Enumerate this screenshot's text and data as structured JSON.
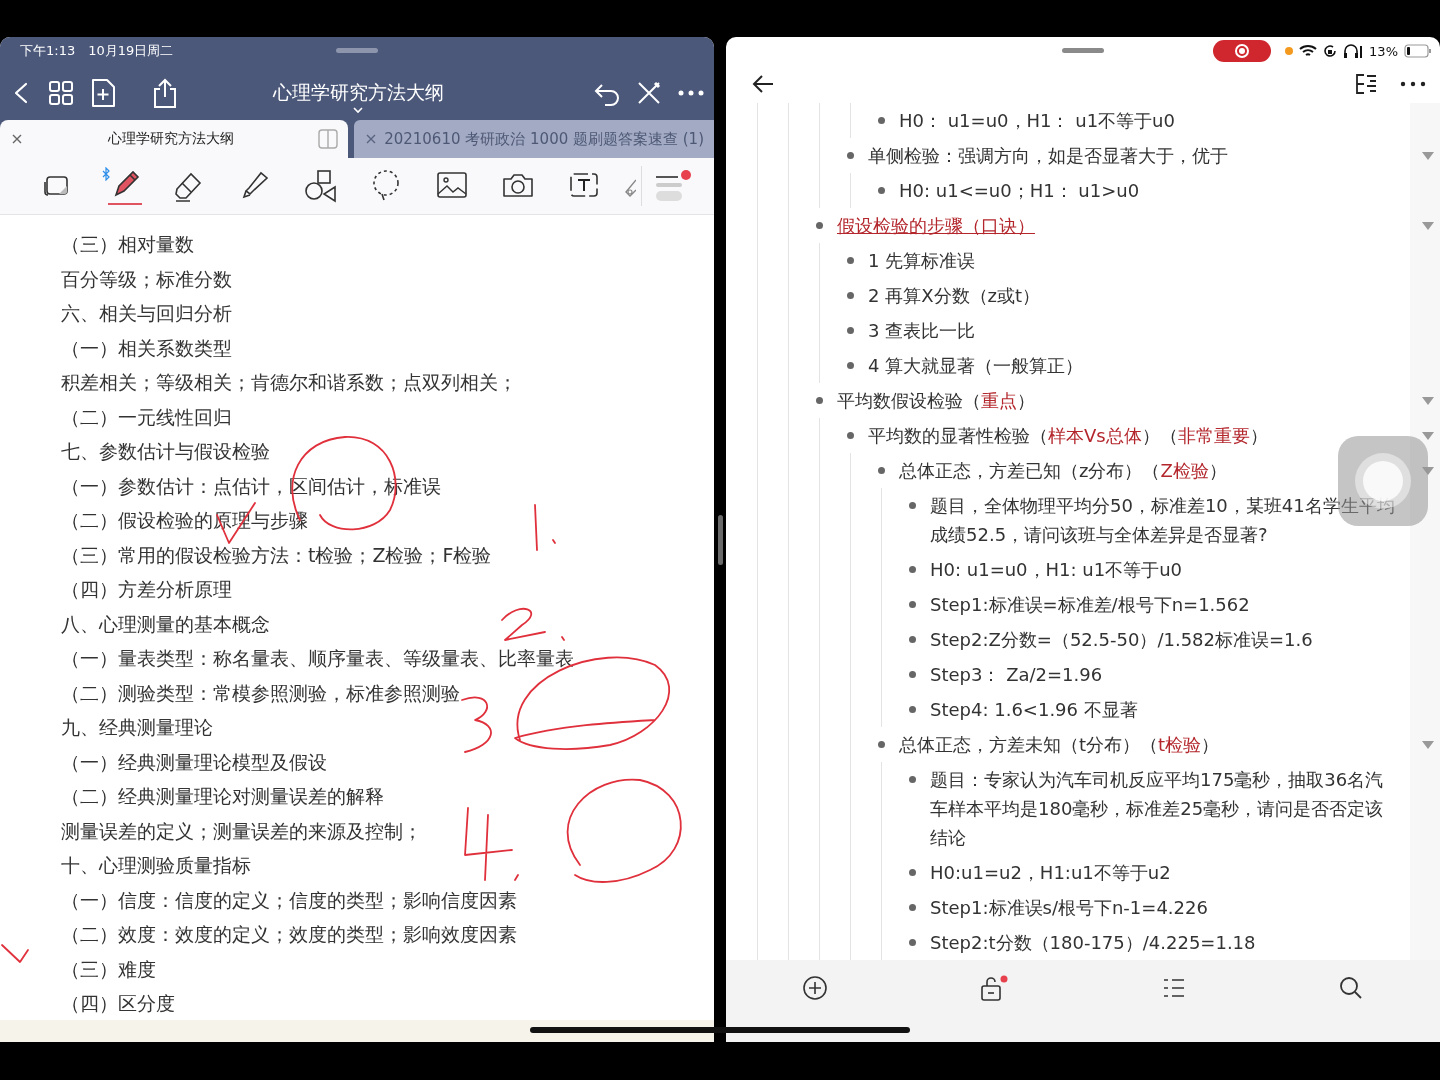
{
  "left_pane": {
    "status_bar": {
      "time": "下午1:13",
      "date": "10月19日周二"
    },
    "title": "心理学研究方法大纲",
    "tabs": [
      {
        "label": "心理学研究方法大纲",
        "selected": true
      },
      {
        "label": "20210610 考研政治 1000 题刷题答案速查 (1)",
        "selected": false
      }
    ],
    "tools": [
      {
        "kind": "page",
        "selected": false
      },
      {
        "kind": "pen",
        "selected": true
      },
      {
        "kind": "eraser",
        "selected": false
      },
      {
        "kind": "highlighter",
        "selected": false
      },
      {
        "kind": "shapes",
        "selected": false
      },
      {
        "kind": "lasso",
        "selected": false
      },
      {
        "kind": "image",
        "selected": false
      },
      {
        "kind": "camera",
        "selected": false
      },
      {
        "kind": "textbox",
        "selected": false
      },
      {
        "kind": "ruler",
        "selected": false
      }
    ],
    "document_lines": [
      "（三）相对量数",
      "百分等级；标准分数",
      "六、相关与回归分析",
      "（一）相关系数类型",
      "积差相关；等级相关；肯德尔和谐系数；点双列相关；",
      "（二）一元线性回归",
      "七、参数估计与假设检验",
      "（一）参数估计：点估计，区间估计，标准误",
      "（二）假设检验的原理与步骤",
      "（三）常用的假设检验方法：t检验；Z检验；F检验",
      "（四）方差分析原理",
      "八、心理测量的基本概念",
      "（一）量表类型：称名量表、顺序量表、等级量表、比率量表",
      "（二）测验类型：常模参照测验，标准参照测验",
      "九、经典测量理论",
      "（一）经典测量理论模型及假设",
      "（二）经典测量理论对测量误差的解释",
      "测量误差的定义；测量误差的来源及控制；",
      "十、心理测验质量指标",
      "（一）信度：信度的定义；信度的类型；影响信度因素",
      "（二）效度：效度的定义；效度的类型；影响效度因素",
      "（三）难度",
      "（四）区分度"
    ]
  },
  "right_pane": {
    "battery": "13%",
    "outline": [
      {
        "children": [
          {
            "children": [
              {
                "children": [
                  {
                    "children": [
                      {
                        "parts": [
                          {
                            "text": "H0： u1=u0，H1： u1不等于u0",
                            "highlight": false,
                            "underline": false
                          }
                        ]
                      }
                    ]
                  },
                  {
                    "parts": [
                      {
                        "text": "单侧检验：强调方向，如是否显著大于，优于",
                        "highlight": false,
                        "underline": false
                      }
                    ],
                    "expanded": true,
                    "children": [
                      {
                        "parts": [
                          {
                            "text": "H0: u1<=u0；H1： u1>u0",
                            "highlight": false,
                            "underline": false
                          }
                        ]
                      }
                    ]
                  }
                ]
              },
              {
                "parts": [
                  {
                    "text": "假设检验的步骤（口诀）",
                    "highlight": true,
                    "underline": true
                  }
                ],
                "expanded": true,
                "children": [
                  {
                    "parts": [
                      {
                        "text": "1 先算标准误",
                        "highlight": false,
                        "underline": false
                      }
                    ]
                  },
                  {
                    "parts": [
                      {
                        "text": "2 再算X分数（z或t）",
                        "highlight": false,
                        "underline": false
                      }
                    ]
                  },
                  {
                    "parts": [
                      {
                        "text": "3 查表比一比",
                        "highlight": false,
                        "underline": false
                      }
                    ]
                  },
                  {
                    "parts": [
                      {
                        "text": "4 算大就显著（一般算正）",
                        "highlight": false,
                        "underline": false
                      }
                    ]
                  }
                ]
              },
              {
                "parts": [
                  {
                    "text": "平均数假设检验（",
                    "highlight": false,
                    "underline": false
                  },
                  {
                    "text": "重点",
                    "highlight": true,
                    "underline": false
                  },
                  {
                    "text": "）",
                    "highlight": false,
                    "underline": false
                  }
                ],
                "expanded": true,
                "children": [
                  {
                    "parts": [
                      {
                        "text": "平均数的显著性检验（",
                        "highlight": false,
                        "underline": false
                      },
                      {
                        "text": "样本Vs总体",
                        "highlight": true,
                        "underline": false
                      },
                      {
                        "text": "）（",
                        "highlight": false,
                        "underline": false
                      },
                      {
                        "text": "非常重要",
                        "highlight": true,
                        "underline": false
                      },
                      {
                        "text": "）",
                        "highlight": false,
                        "underline": false
                      }
                    ],
                    "expanded": true,
                    "children": [
                      {
                        "parts": [
                          {
                            "text": "总体正态，方差已知（z分布）（",
                            "highlight": false,
                            "underline": false
                          },
                          {
                            "text": "Z检验",
                            "highlight": true,
                            "underline": false
                          },
                          {
                            "text": "）",
                            "highlight": false,
                            "underline": false
                          }
                        ],
                        "expanded": true,
                        "children": [
                          {
                            "parts": [
                              {
                                "text": "题目，全体物理平均分50，标准差10，某班41名学生平均成绩52.5，请问该班与全体差异是否显著?",
                                "highlight": false,
                                "underline": false
                              }
                            ]
                          },
                          {
                            "parts": [
                              {
                                "text": "H0: u1=u0，H1: u1不等于u0",
                                "highlight": false,
                                "underline": false
                              }
                            ]
                          },
                          {
                            "parts": [
                              {
                                "text": "Step1:标准误=标准差/根号下n=1.562",
                                "highlight": false,
                                "underline": false
                              }
                            ]
                          },
                          {
                            "parts": [
                              {
                                "text": "Step2:Z分数=（52.5-50）/1.582标准误=1.6",
                                "highlight": false,
                                "underline": false
                              }
                            ]
                          },
                          {
                            "parts": [
                              {
                                "text": "Step3： Za/2=1.96",
                                "highlight": false,
                                "underline": false
                              }
                            ]
                          },
                          {
                            "parts": [
                              {
                                "text": "Step4: 1.6<1.96 不显著",
                                "highlight": false,
                                "underline": false
                              }
                            ]
                          }
                        ]
                      },
                      {
                        "parts": [
                          {
                            "text": "总体正态，方差未知（t分布）（",
                            "highlight": false,
                            "underline": false
                          },
                          {
                            "text": "t检验",
                            "highlight": true,
                            "underline": false
                          },
                          {
                            "text": "）",
                            "highlight": false,
                            "underline": false
                          }
                        ],
                        "expanded": true,
                        "children": [
                          {
                            "parts": [
                              {
                                "text": "题目：专家认为汽车司机反应平均175毫秒，抽取36名汽车样本平均是180毫秒，标准差25毫秒，请问是否否定该结论",
                                "highlight": false,
                                "underline": false
                              }
                            ]
                          },
                          {
                            "parts": [
                              {
                                "text": "H0:u1=u2，H1:u1不等于u2",
                                "highlight": false,
                                "underline": false
                              }
                            ]
                          },
                          {
                            "parts": [
                              {
                                "text": "Step1:标准误s/根号下n-1=4.226",
                                "highlight": false,
                                "underline": false
                              }
                            ]
                          },
                          {
                            "parts": [
                              {
                                "text": "Step2:t分数（180-175）/4.225=1.18",
                                "highlight": false,
                                "underline": false
                              }
                            ]
                          }
                        ]
                      }
                    ]
                  }
                ]
              }
            ]
          }
        ]
      }
    ]
  }
}
